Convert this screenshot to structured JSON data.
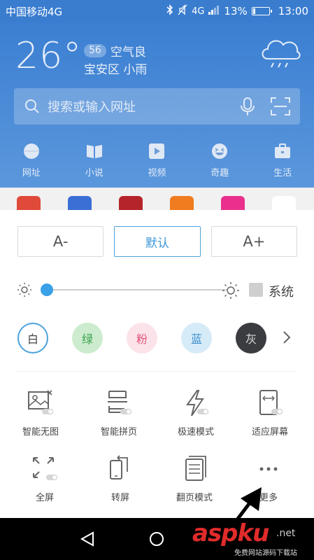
{
  "status_bar": {
    "carrier": "中国移动4G",
    "network": "4G",
    "battery": "13%",
    "battery_level": 0.13,
    "time": "13:00"
  },
  "weather": {
    "temperature": "26°",
    "aqi_value": "56",
    "aqi_label": "空气良",
    "location": "宝安区  小雨",
    "icon": "cloud-rain-icon"
  },
  "search": {
    "placeholder": "搜索或输入网址"
  },
  "nav": [
    {
      "label": "网址",
      "icon": "globe-icon"
    },
    {
      "label": "小说",
      "icon": "book-icon"
    },
    {
      "label": "视频",
      "icon": "video-icon"
    },
    {
      "label": "奇趣",
      "icon": "smile-icon"
    },
    {
      "label": "生活",
      "icon": "briefcase-icon"
    }
  ],
  "apps": [
    {
      "color": "#e04a3a"
    },
    {
      "color": "#3b6fd6"
    },
    {
      "color": "#b5242a"
    },
    {
      "color": "#f07c1f"
    },
    {
      "color": "#e9308c"
    },
    {
      "color": "#ffffff"
    }
  ],
  "font_size": {
    "smaller": "A-",
    "default": "默认",
    "larger": "A+"
  },
  "brightness": {
    "level": 0.0,
    "system_label": "系统"
  },
  "themes": [
    {
      "label": "白",
      "bg": "#ffffff",
      "fg": "#444444",
      "border": "#4ca2dc",
      "selected": true
    },
    {
      "label": "绿",
      "bg": "#cdeccf",
      "fg": "#3aa24a",
      "border": "",
      "selected": false
    },
    {
      "label": "粉",
      "bg": "#fce3ea",
      "fg": "#e0557a",
      "border": "",
      "selected": false
    },
    {
      "label": "蓝",
      "bg": "#d6ebf8",
      "fg": "#3b8fcc",
      "border": "",
      "selected": false
    },
    {
      "label": "灰",
      "bg": "#3a3c40",
      "fg": "#dddddd",
      "border": "",
      "selected": false
    }
  ],
  "tools": [
    {
      "label": "智能无图",
      "icon": "no-image-icon"
    },
    {
      "label": "智能拼页",
      "icon": "page-join-icon"
    },
    {
      "label": "极速模式",
      "icon": "lightning-icon"
    },
    {
      "label": "适应屏幕",
      "icon": "fit-screen-icon"
    },
    {
      "label": "全屏",
      "icon": "fullscreen-icon"
    },
    {
      "label": "转屏",
      "icon": "rotate-screen-icon"
    },
    {
      "label": "翻页模式",
      "icon": "page-flip-icon"
    },
    {
      "label": "更多",
      "icon": "more-icon"
    }
  ],
  "watermark": {
    "brand": "aspku",
    "tld": ".net",
    "tagline": "免费网站源码下载站"
  },
  "colors": {
    "accent": "#3aa0e8",
    "header": "#3b7fd2"
  }
}
